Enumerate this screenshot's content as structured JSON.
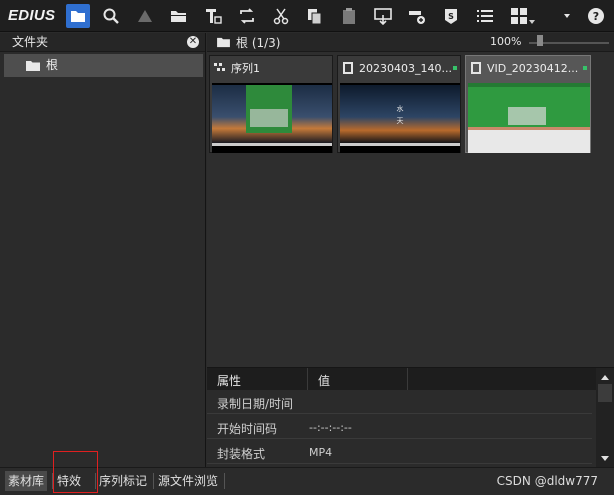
{
  "app": {
    "logo": "EDIUS"
  },
  "toolbar": {
    "buttons": [
      "folder",
      "search",
      "up",
      "open-folder",
      "text-clip",
      "replace",
      "cut",
      "copy",
      "paste",
      "insert",
      "add-to-timeline",
      "shape",
      "list-view",
      "grid-view",
      "menu"
    ]
  },
  "folder_panel": {
    "title": "文件夹",
    "root_label": "根"
  },
  "path_bar": {
    "path": "根 (1/3)",
    "zoom": "100%"
  },
  "clips": [
    {
      "title": "序列1",
      "type": "sequence",
      "selected": false
    },
    {
      "title": "20230403_140...",
      "type": "video",
      "selected": false
    },
    {
      "title": "VID_20230412...",
      "type": "video",
      "selected": true
    }
  ],
  "properties": {
    "headers": [
      "属性",
      "值"
    ],
    "rows": [
      {
        "key": "录制日期/时间",
        "value": ""
      },
      {
        "key": "开始时间码",
        "value": "--:--:--:--"
      },
      {
        "key": "封装格式",
        "value": "MP4"
      }
    ]
  },
  "tabs": [
    "素材库",
    "特效",
    "序列标记",
    "源文件浏览"
  ],
  "active_tab": "素材库",
  "watermark": "CSDN @dldw777",
  "colors": {
    "accent": "#2f6fd0",
    "status_green": "#37c26a",
    "highlight": "#e02020"
  }
}
